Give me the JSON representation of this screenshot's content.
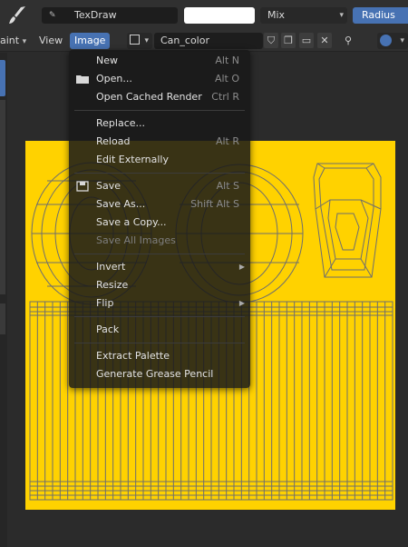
{
  "toolbar": {
    "brush_name": "TexDraw",
    "blend_mode": "Mix",
    "radius_label": "Radius"
  },
  "header": {
    "mode_partial": "aint",
    "menus": [
      "View",
      "Image"
    ],
    "image_name": "Can_color"
  },
  "image_menu": {
    "items": [
      {
        "label": "New",
        "shortcut": "Alt N",
        "mnemonic": "N"
      },
      {
        "label": "Open...",
        "shortcut": "Alt O",
        "mnemonic": "O"
      },
      {
        "label": "Open Cached Render",
        "shortcut": "Ctrl R"
      },
      {
        "label": "Replace...",
        "shortcut": ""
      },
      {
        "label": "Reload",
        "shortcut": "Alt R"
      },
      {
        "label": "Edit Externally",
        "shortcut": ""
      },
      {
        "label": "Save",
        "shortcut": "Alt S"
      },
      {
        "label": "Save As...",
        "shortcut": "Shift Alt S"
      },
      {
        "label": "Save a Copy...",
        "shortcut": ""
      },
      {
        "label": "Save All Images",
        "shortcut": "",
        "disabled": true
      },
      {
        "label": "Invert",
        "shortcut": "",
        "submenu": true
      },
      {
        "label": "Resize",
        "shortcut": ""
      },
      {
        "label": "Flip",
        "shortcut": "",
        "submenu": true
      },
      {
        "label": "Pack",
        "shortcut": ""
      },
      {
        "label": "Extract Palette",
        "shortcut": ""
      },
      {
        "label": "Generate Grease Pencil",
        "shortcut": ""
      }
    ]
  },
  "colors": {
    "accent": "#4772b3",
    "canvas_bg": "#ffd200",
    "wire": "#6e6e6e"
  }
}
